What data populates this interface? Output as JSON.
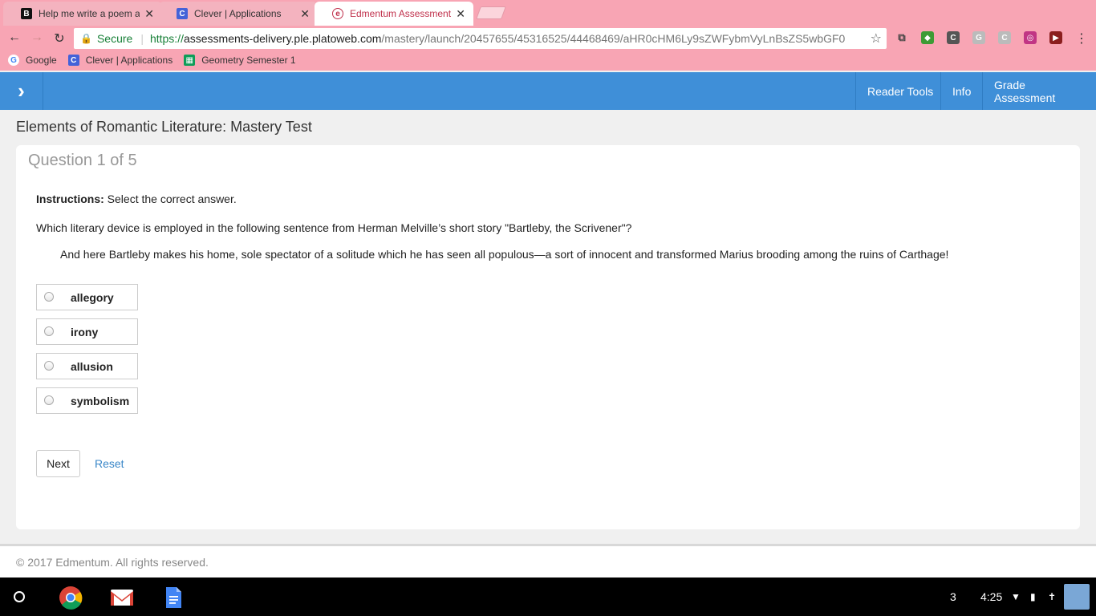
{
  "browser": {
    "tabs": [
      {
        "title": "Help me write a poem as",
        "icon": "b-icon",
        "active": false
      },
      {
        "title": "Clever | Applications",
        "icon": "clever-icon",
        "active": false
      },
      {
        "title": "Edmentum Assessment",
        "icon": "edmentum-icon",
        "active": true
      }
    ],
    "security_label": "Secure",
    "url_scheme": "https://",
    "url_host": "assessments-delivery.ple.platoweb.com",
    "url_path": "/mastery/launch/20457655/45316525/44468469/aHR0cHM6Ly9sZWFybmVyLnBsZS5wbGF0",
    "bookmarks": [
      {
        "label": "Google",
        "icon": "google-icon"
      },
      {
        "label": "Clever | Applications",
        "icon": "clever-icon"
      },
      {
        "label": "Geometry Semester 1",
        "icon": "sheets-icon"
      }
    ]
  },
  "header": {
    "reader_tools": "Reader Tools",
    "info": "Info",
    "grade_assessment": "Grade Assessment",
    "color": "#3f8fd8"
  },
  "page_title": "Elements of Romantic Literature: Mastery Test",
  "question": {
    "number_label": "Question 1 of 5",
    "instructions_label": "Instructions:",
    "instructions_text": "Select the correct answer.",
    "prompt": "Which literary device is employed in the following sentence from Herman Melville’s short story \"Bartleby, the Scrivener\"?",
    "quote": "And here Bartleby makes his home, sole spectator of a solitude which he has seen all populous—a sort of innocent and transformed Marius brooding among the ruins of Carthage!",
    "options": [
      "allegory",
      "irony",
      "allusion",
      "symbolism"
    ]
  },
  "actions": {
    "next": "Next",
    "reset": "Reset"
  },
  "footer": {
    "copyright": "© 2017 Edmentum. All rights reserved."
  },
  "shelf": {
    "notification_count": "3",
    "time": "4:25"
  }
}
